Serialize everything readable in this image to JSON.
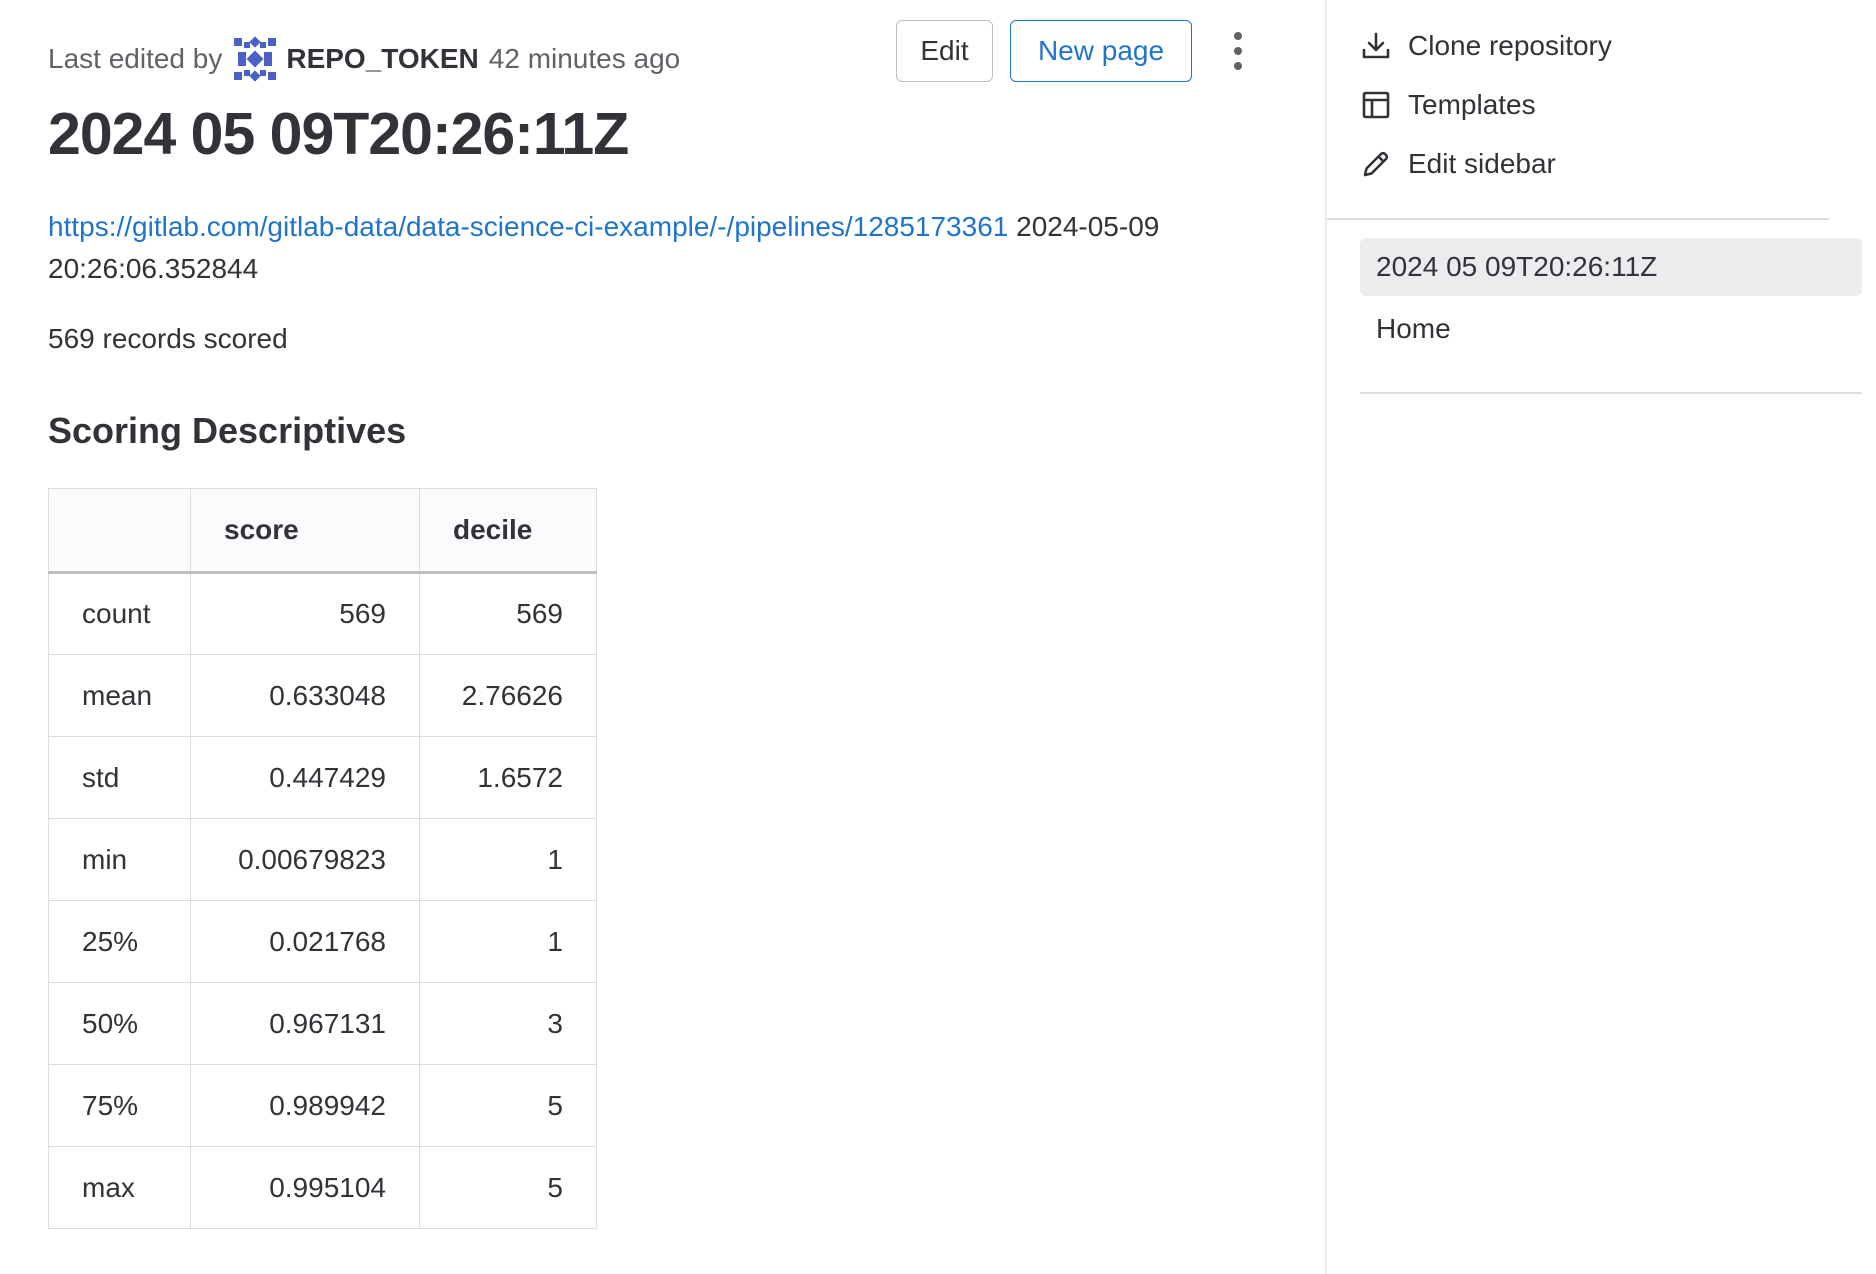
{
  "header": {
    "last_edited_prefix": "Last edited by",
    "author": "REPO_TOKEN",
    "time_ago": "42 minutes ago",
    "edit_label": "Edit",
    "new_page_label": "New page",
    "more_icon": "ellipsis-vertical-icon"
  },
  "page": {
    "title": "2024 05 09T20:26:11Z",
    "pipeline_link": "https://gitlab.com/gitlab-data/data-science-ci-example/-/pipelines/1285173361",
    "timestamp": "2024-05-09 20:26:06.352844",
    "records_text": "569 records scored",
    "section_heading": "Scoring Descriptives"
  },
  "table": {
    "headers": [
      "",
      "score",
      "decile"
    ],
    "rows": [
      [
        "count",
        "569",
        "569"
      ],
      [
        "mean",
        "0.633048",
        "2.76626"
      ],
      [
        "std",
        "0.447429",
        "1.6572"
      ],
      [
        "min",
        "0.00679823",
        "1"
      ],
      [
        "25%",
        "0.021768",
        "1"
      ],
      [
        "50%",
        "0.967131",
        "3"
      ],
      [
        "75%",
        "0.989942",
        "5"
      ],
      [
        "max",
        "0.995104",
        "5"
      ]
    ]
  },
  "sidebar": {
    "actions": [
      {
        "label": "Clone repository",
        "icon": "download-icon"
      },
      {
        "label": "Templates",
        "icon": "template-icon"
      },
      {
        "label": "Edit sidebar",
        "icon": "pencil-icon"
      }
    ],
    "pages": [
      {
        "label": "2024 05 09T20:26:11Z",
        "active": true
      },
      {
        "label": "Home",
        "active": false
      }
    ]
  },
  "colors": {
    "link": "#1f75cb",
    "text": "#333238",
    "muted": "#626168",
    "avatar": "#4a62c8"
  }
}
